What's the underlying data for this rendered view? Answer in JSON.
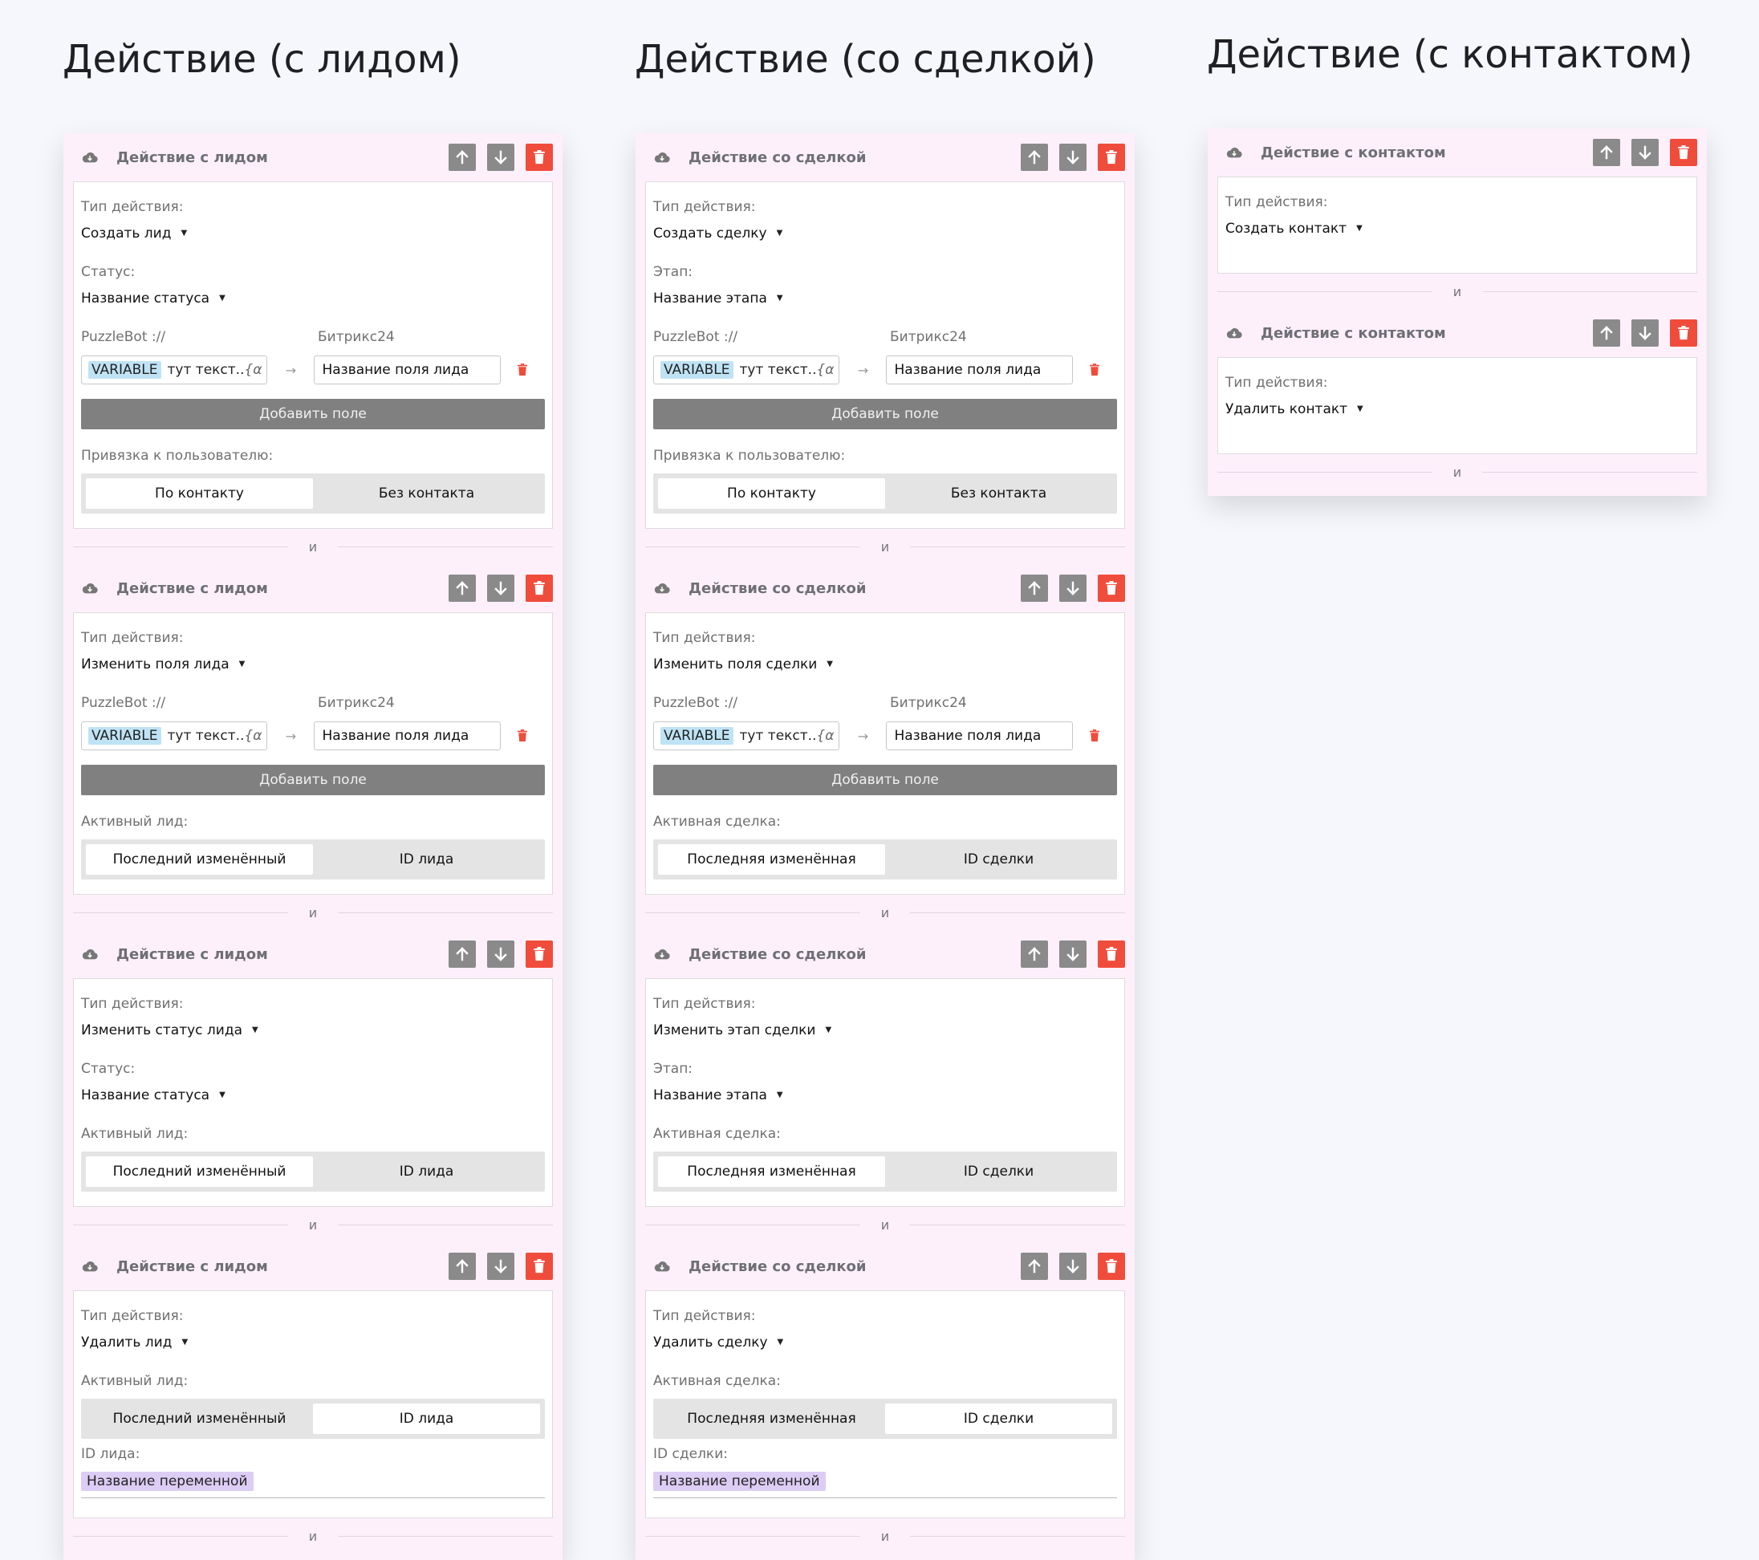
{
  "columns": [
    {
      "title": "Действие (с лидом)",
      "sep": "и",
      "actions": [
        {
          "header": "Действие с лидом",
          "blocks": [
            {
              "k": "label",
              "text": "Тип действия:"
            },
            {
              "k": "select",
              "value": "Создать лид"
            },
            {
              "k": "label",
              "text": "Статус:"
            },
            {
              "k": "select",
              "value": "Название статуса"
            },
            {
              "k": "map",
              "left": "PuzzleBot ://",
              "right": "Битрикс24",
              "tag": "VARIABLE",
              "text": "тут текст...",
              "formula": "{α",
              "arrow": "→",
              "field": "Название поля лида"
            },
            {
              "k": "add",
              "text": "Добавить поле"
            },
            {
              "k": "label",
              "text": "Привязка к пользователю:"
            },
            {
              "k": "seg",
              "opts": [
                "По контакту",
                "Без контакта"
              ],
              "active": 0
            }
          ]
        },
        {
          "header": "Действие с лидом",
          "blocks": [
            {
              "k": "label",
              "text": "Тип действия:"
            },
            {
              "k": "select",
              "value": "Изменить поля лида"
            },
            {
              "k": "map",
              "left": "PuzzleBot ://",
              "right": "Битрикс24",
              "tag": "VARIABLE",
              "text": "тут текст...",
              "formula": "{α",
              "arrow": "→",
              "field": "Название поля лида"
            },
            {
              "k": "add",
              "text": "Добавить поле"
            },
            {
              "k": "label",
              "text": "Активный лид:"
            },
            {
              "k": "seg",
              "opts": [
                "Последний изменённый",
                "ID лида"
              ],
              "active": 0
            }
          ]
        },
        {
          "header": "Действие с лидом",
          "blocks": [
            {
              "k": "label",
              "text": "Тип действия:"
            },
            {
              "k": "select",
              "value": "Изменить статус лида"
            },
            {
              "k": "label",
              "text": "Статус:"
            },
            {
              "k": "select",
              "value": "Название статуса"
            },
            {
              "k": "label",
              "text": "Активный лид:"
            },
            {
              "k": "seg",
              "opts": [
                "Последний изменённый",
                "ID лида"
              ],
              "active": 0
            }
          ]
        },
        {
          "header": "Действие с лидом",
          "blocks": [
            {
              "k": "label",
              "text": "Тип действия:"
            },
            {
              "k": "select",
              "value": "Удалить лид"
            },
            {
              "k": "label",
              "text": "Активный лид:"
            },
            {
              "k": "seg",
              "opts": [
                "Последний изменённый",
                "ID лида"
              ],
              "active": 1
            },
            {
              "k": "label",
              "text": "ID лида:"
            },
            {
              "k": "var",
              "value": "Название переменной"
            }
          ]
        }
      ]
    },
    {
      "title": "Действие (со сделкой)",
      "sep": "и",
      "actions": [
        {
          "header": "Действие со сделкой",
          "blocks": [
            {
              "k": "label",
              "text": "Тип действия:"
            },
            {
              "k": "select",
              "value": "Создать сделку"
            },
            {
              "k": "label",
              "text": "Этап:"
            },
            {
              "k": "select",
              "value": "Название этапа"
            },
            {
              "k": "map",
              "left": "PuzzleBot ://",
              "right": "Битрикс24",
              "tag": "VARIABLE",
              "text": "тут текст...",
              "formula": "{α",
              "arrow": "→",
              "field": "Название поля лида"
            },
            {
              "k": "add",
              "text": "Добавить поле"
            },
            {
              "k": "label",
              "text": "Привязка к пользователю:"
            },
            {
              "k": "seg",
              "opts": [
                "По контакту",
                "Без контакта"
              ],
              "active": 0
            }
          ]
        },
        {
          "header": "Действие со сделкой",
          "blocks": [
            {
              "k": "label",
              "text": "Тип действия:"
            },
            {
              "k": "select",
              "value": "Изменить поля сделки"
            },
            {
              "k": "map",
              "left": "PuzzleBot ://",
              "right": "Битрикс24",
              "tag": "VARIABLE",
              "text": "тут текст...",
              "formula": "{α",
              "arrow": "→",
              "field": "Название поля лида"
            },
            {
              "k": "add",
              "text": "Добавить поле"
            },
            {
              "k": "label",
              "text": "Активная сделка:"
            },
            {
              "k": "seg",
              "opts": [
                "Последняя изменённая",
                "ID сделки"
              ],
              "active": 0
            }
          ]
        },
        {
          "header": "Действие со сделкой",
          "blocks": [
            {
              "k": "label",
              "text": "Тип действия:"
            },
            {
              "k": "select",
              "value": "Изменить этап сделки"
            },
            {
              "k": "label",
              "text": "Этап:"
            },
            {
              "k": "select",
              "value": "Название этапа"
            },
            {
              "k": "label",
              "text": "Активная сделка:"
            },
            {
              "k": "seg",
              "opts": [
                "Последняя изменённая",
                "ID сделки"
              ],
              "active": 0
            }
          ]
        },
        {
          "header": "Действие со сделкой",
          "blocks": [
            {
              "k": "label",
              "text": "Тип действия:"
            },
            {
              "k": "select",
              "value": "Удалить сделку"
            },
            {
              "k": "label",
              "text": "Активная сделка:"
            },
            {
              "k": "seg",
              "opts": [
                "Последняя изменённая",
                "ID сделки"
              ],
              "active": 1
            },
            {
              "k": "label",
              "text": "ID сделки:"
            },
            {
              "k": "var",
              "value": "Название переменной"
            }
          ]
        }
      ]
    },
    {
      "title": "Действие (с контактом)",
      "sep": "и",
      "actions": [
        {
          "header": "Действие с контактом",
          "blocks": [
            {
              "k": "label",
              "text": "Тип действия:"
            },
            {
              "k": "select",
              "value": "Создать контакт"
            }
          ]
        },
        {
          "header": "Действие с контактом",
          "blocks": [
            {
              "k": "label",
              "text": "Тип действия:"
            },
            {
              "k": "select",
              "value": "Удалить контакт"
            }
          ]
        }
      ]
    }
  ],
  "colors": {
    "panel_bg": "#fdf0fb",
    "gray_button": "#8a8a8a",
    "delete_button": "#f04c3c",
    "variable_tag": "#bfe3f5",
    "variable_chip": "#dccdf5"
  },
  "icons": {
    "cloud": "cloud-icon",
    "up": "arrow-up-icon",
    "down": "arrow-down-icon",
    "delete": "trash-icon"
  }
}
